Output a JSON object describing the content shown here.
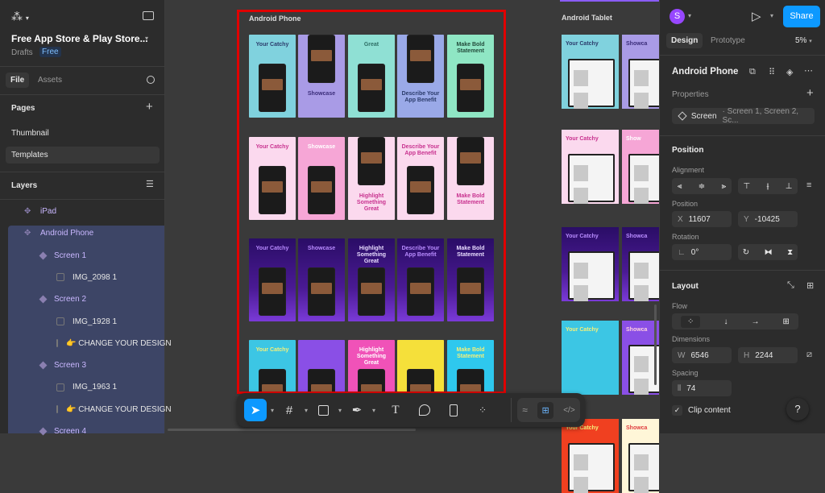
{
  "file": {
    "title": "Free App Store & Play Store...",
    "location": "Drafts",
    "plan_badge": "Free"
  },
  "left_tabs": [
    "File",
    "Assets"
  ],
  "pages": {
    "heading": "Pages",
    "items": [
      "Thumbnail",
      "Templates"
    ]
  },
  "layers": {
    "heading": "Layers",
    "items": [
      {
        "label": "iPad",
        "type": "frame",
        "indent": 1
      },
      {
        "label": "Android Phone",
        "type": "frame",
        "indent": 1,
        "selected": true
      },
      {
        "label": "Screen 1",
        "type": "component",
        "indent": 2
      },
      {
        "label": "IMG_2098 1",
        "type": "image",
        "indent": 3
      },
      {
        "label": "Screen 2",
        "type": "component",
        "indent": 2
      },
      {
        "label": "IMG_1928 1",
        "type": "image",
        "indent": 3
      },
      {
        "label": "👉 CHANGE YOUR DESIGN",
        "type": "image",
        "indent": 3
      },
      {
        "label": "Screen 3",
        "type": "component",
        "indent": 2
      },
      {
        "label": "IMG_1963 1",
        "type": "image",
        "indent": 3
      },
      {
        "label": "👉 CHANGE YOUR DESIGN",
        "type": "image",
        "indent": 3
      },
      {
        "label": "Screen 4",
        "type": "component",
        "indent": 2
      }
    ]
  },
  "canvas": {
    "phone_frame_label": "Android Phone",
    "tablet_frame_label": "Android Tablet",
    "phone_rows": [
      [
        {
          "title": "Your Catchy",
          "bg": "#80d2de",
          "fg": "#2b3b6b"
        },
        {
          "title": "Showcase",
          "bg": "#a99be6",
          "fg": "#3b2d7a",
          "pos": "bottom"
        },
        {
          "title": "Great",
          "bg": "#8fe0d4",
          "fg": "#2f6f66"
        },
        {
          "title": "Describe Your App Benefit",
          "bg": "#9aa9e8",
          "fg": "#2b3b6b",
          "pos": "bottom"
        },
        {
          "title": "Make Bold Statement",
          "bg": "#8fe6c4",
          "fg": "#234b3b"
        }
      ],
      [
        {
          "title": "Your Catchy",
          "bg": "#fbd9ee",
          "fg": "#c8328f"
        },
        {
          "title": "Showcase",
          "bg": "#f6a6d6",
          "fg": "#ffffff"
        },
        {
          "title": "Highlight Something Great",
          "bg": "#fbd9ee",
          "fg": "#c8328f",
          "pos": "bottom"
        },
        {
          "title": "Describe Your App Benefit",
          "bg": "#fbd9ee",
          "fg": "#c8328f"
        },
        {
          "title": "Make Bold Statement",
          "bg": "#fbd9ee",
          "fg": "#c8328f",
          "pos": "bottom"
        }
      ],
      [
        {
          "title": "Your Catchy",
          "bg": "#4a1a94",
          "fg": "#b98cff"
        },
        {
          "title": "Showcase",
          "bg": "#4a1a94",
          "fg": "#b98cff"
        },
        {
          "title": "Highlight Something Great",
          "bg": "#4a1a94",
          "fg": "#e8dcff"
        },
        {
          "title": "Describe Your App Benefit",
          "bg": "#4a1a94",
          "fg": "#b98cff"
        },
        {
          "title": "Make Bold Statement",
          "bg": "#4a1a94",
          "fg": "#e8dcff"
        }
      ],
      [
        {
          "title": "Your Catchy",
          "bg": "#3cc6e4",
          "fg": "#f5f07a"
        },
        {
          "title": "",
          "bg": "#8a4fe6",
          "fg": "#fff"
        },
        {
          "title": "Highlight Something Great",
          "bg": "#f052b8",
          "fg": "#ffffff"
        },
        {
          "title": "",
          "bg": "#f5e03a",
          "fg": "#222"
        },
        {
          "title": "Make Bold Statement",
          "bg": "#2ec8ee",
          "fg": "#f5f07a"
        }
      ]
    ],
    "tablet_rows": [
      [
        {
          "title": "Your Catchy",
          "bg": "#80d2de",
          "fg": "#2b3b6b"
        },
        {
          "title": "Showca",
          "bg": "#a99be6",
          "fg": "#3b2d7a"
        }
      ],
      [
        {
          "title": "Your Catchy",
          "bg": "#fbd9ee",
          "fg": "#c8328f"
        },
        {
          "title": "Show",
          "bg": "#f6a6d6",
          "fg": "#ffffff"
        }
      ],
      [
        {
          "title": "Your Catchy",
          "bg": "#4a1a94",
          "fg": "#b98cff"
        },
        {
          "title": "Showca",
          "bg": "#4a1a94",
          "fg": "#b98cff"
        }
      ],
      [
        {
          "title": "Your Catchy",
          "bg": "#3cc6e4",
          "fg": "#f5f07a"
        },
        {
          "title": "Showca",
          "bg": "#8a4fe6",
          "fg": "#ffd0e0"
        }
      ],
      [
        {
          "title": "Your Catchy",
          "bg": "#f04020",
          "fg": "#f5f07a"
        },
        {
          "title": "Showca",
          "bg": "#fff6d8",
          "fg": "#e04040"
        }
      ]
    ]
  },
  "toolbar": {
    "tools": [
      "move",
      "frame",
      "shape",
      "pen",
      "text",
      "comment",
      "actions",
      "components"
    ],
    "modes": [
      "draw",
      "design",
      "dev"
    ]
  },
  "right": {
    "avatar_initial": "S",
    "share_label": "Share",
    "tabs": [
      "Design",
      "Prototype"
    ],
    "zoom": "5%",
    "selection_name": "Android Phone",
    "properties_heading": "Properties",
    "property": {
      "name": "Screen",
      "values": "Screen 1, Screen 2, Sc..."
    },
    "position_heading": "Position",
    "alignment_label": "Alignment",
    "position_label": "Position",
    "x": "11607",
    "y": "-10425",
    "rotation_label": "Rotation",
    "rotation": "0°",
    "layout_heading": "Layout",
    "flow_label": "Flow",
    "dimensions_label": "Dimensions",
    "w": "6546",
    "h": "2244",
    "spacing_label": "Spacing",
    "spacing": "74",
    "clip_label": "Clip content",
    "clip_checked": true,
    "help": "?",
    "accent": "#0d99ff"
  }
}
